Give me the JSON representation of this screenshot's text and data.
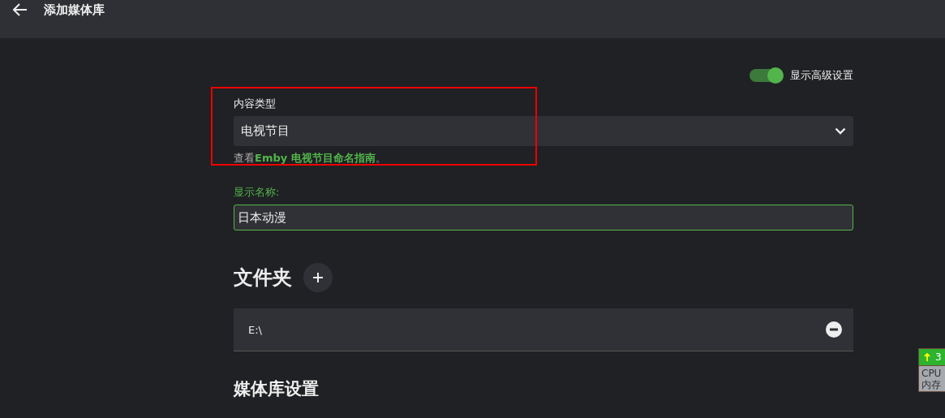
{
  "header": {
    "title": "添加媒体库"
  },
  "advanced_toggle": {
    "label": "显示高级设置",
    "on": true
  },
  "content_type": {
    "label": "内容类型",
    "value": "电视节目",
    "highlighted": true,
    "hint_prefix": "查看",
    "hint_link": "Emby 电视节目命名指南",
    "hint_suffix": "。"
  },
  "display_name": {
    "label": "显示名称:",
    "value": "日本动漫",
    "focused": true
  },
  "folders": {
    "heading": "文件夹",
    "items": [
      {
        "path": "E:\\"
      }
    ]
  },
  "library_settings": {
    "heading": "媒体库设置"
  },
  "monitor_widget": {
    "upload": "3",
    "cpu": "CPU",
    "memory": "内存"
  }
}
